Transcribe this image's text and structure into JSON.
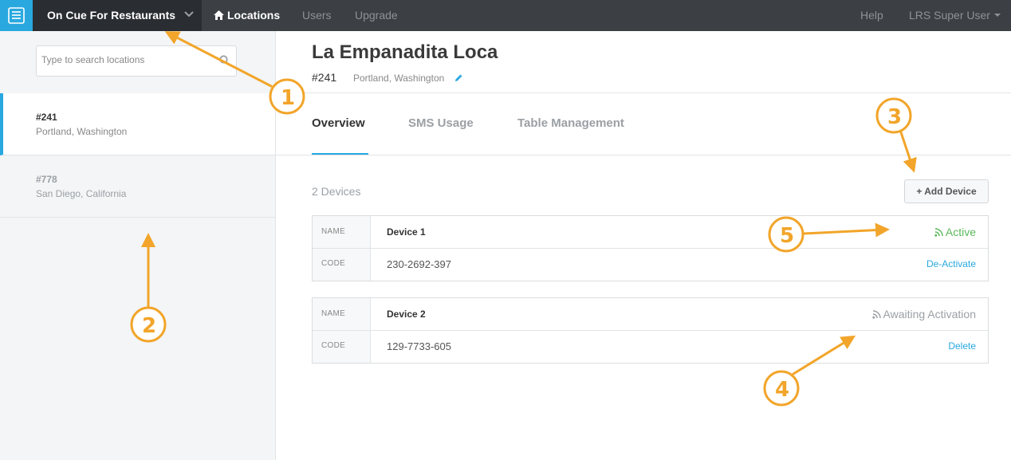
{
  "topnav": {
    "app_name": "On Cue For Restaurants",
    "items": [
      "Locations",
      "Users",
      "Upgrade"
    ],
    "help": "Help",
    "user": "LRS Super User"
  },
  "sidebar": {
    "search_placeholder": "Type to search locations",
    "locations": [
      {
        "number": "#241",
        "place": "Portland, Washington"
      },
      {
        "number": "#778",
        "place": "San Diego, California"
      }
    ]
  },
  "location": {
    "title": "La Empanadita Loca",
    "number": "#241",
    "place": "Portland, Washington"
  },
  "tabs": [
    "Overview",
    "SMS Usage",
    "Table Management"
  ],
  "devices": {
    "count_label": "2 Devices",
    "add_label": "+ Add Device",
    "name_label": "NAME",
    "code_label": "CODE",
    "items": [
      {
        "name": "Device 1",
        "code": "230-2692-397",
        "status": "Active",
        "action": "De-Activate"
      },
      {
        "name": "Device 2",
        "code": "129-7733-605",
        "status": "Awaiting Activation",
        "action": "Delete"
      }
    ]
  },
  "annotations": [
    "1",
    "2",
    "3",
    "4",
    "5"
  ],
  "colors": {
    "accent": "#29a8e0",
    "nav_bg": "#3c3f44",
    "active_status": "#5cb85c",
    "annotation": "#f2a52a"
  }
}
